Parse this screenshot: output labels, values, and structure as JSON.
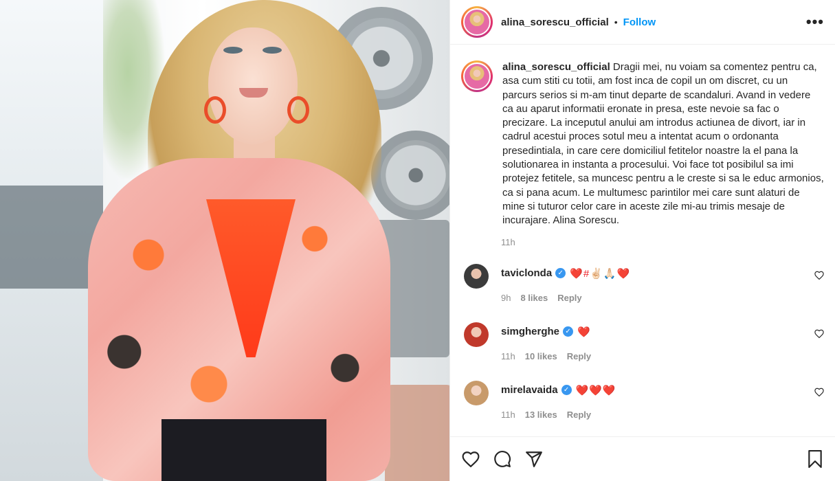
{
  "post": {
    "username": "alina_sorescu_official",
    "follow_label": "Follow",
    "more_label": "•••",
    "caption": {
      "username": "alina_sorescu_official",
      "text": " Dragii mei, nu voiam sa comentez pentru ca, asa cum stiti cu totii, am fost inca de copil un om discret, cu un parcurs serios si m-am tinut departe de scandaluri. Avand in vedere ca au aparut informatii eronate in presa, este nevoie sa fac o precizare. La inceputul anului am introdus actiunea de divort, iar in cadrul acestui proces sotul meu a intentat acum o ordonanta presedintiala, in care cere domiciliul fetitelor noastre la el pana la solutionarea in instanta a procesului. Voi face tot posibilul sa imi protejez fetitele, sa muncesc pentru a le creste si sa le educ armonios, ca si pana acum. Le multumesc parintilor mei care sunt alaturi de mine si tuturor celor care in aceste zile mi-au trimis mesaje de incurajare. Alina Sorescu.",
      "time": "11h"
    }
  },
  "comments": [
    {
      "username": "taviclonda",
      "verified": true,
      "text": "❤️#✌🏻🙏🏻❤️",
      "time": "9h",
      "likes": "8 likes",
      "reply": "Reply",
      "avatar_color": "#3b3b3b"
    },
    {
      "username": "simgherghe",
      "verified": true,
      "text": "❤️",
      "time": "11h",
      "likes": "10 likes",
      "reply": "Reply",
      "avatar_color": "#c0392b"
    },
    {
      "username": "mirelavaida",
      "verified": true,
      "text": "❤️❤️❤️",
      "time": "11h",
      "likes": "13 likes",
      "reply": "Reply",
      "avatar_color": "#c89a6a"
    }
  ],
  "icons": {
    "verified": "✓",
    "like": "heart-icon",
    "comment": "comment-icon",
    "share": "share-icon",
    "save": "bookmark-icon"
  }
}
